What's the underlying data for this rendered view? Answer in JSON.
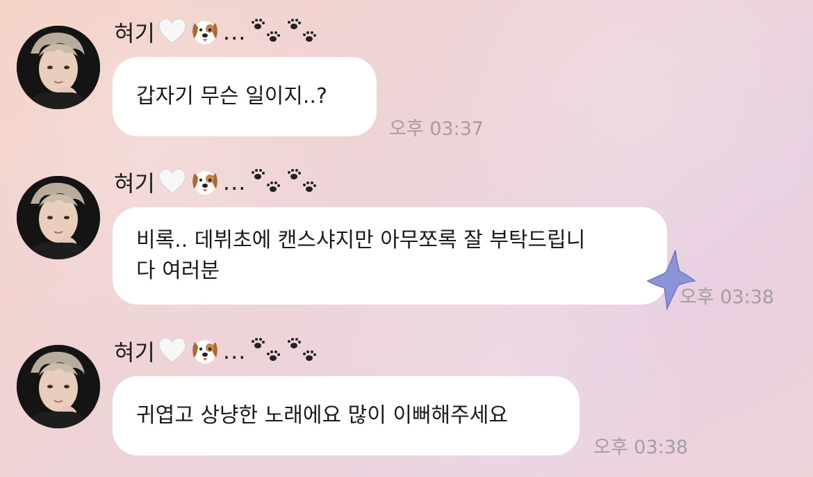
{
  "messages": [
    {
      "sender": "혀기",
      "sender_suffix": "...",
      "sender_icons": [
        "white-heart-icon",
        "dog-face-icon",
        "paw-prints-icon",
        "paw-prints-icon"
      ],
      "text": "갑자기 무슨 일이지..?",
      "time": "오후 03:37"
    },
    {
      "sender": "혀기",
      "sender_suffix": "...",
      "sender_icons": [
        "white-heart-icon",
        "dog-face-icon",
        "paw-prints-icon",
        "paw-prints-icon"
      ],
      "text": "비록.. 데뷔초에 캔스샤지만 아무쪼록 잘 부탁드립니\n다 여러분",
      "time": "오후 03:38"
    },
    {
      "sender": "혀기",
      "sender_suffix": "...",
      "sender_icons": [
        "white-heart-icon",
        "dog-face-icon",
        "paw-prints-icon",
        "paw-prints-icon"
      ],
      "text": "귀엽고 상냥한 노래에요 많이 이뻐해주세요",
      "time": "오후 03:38"
    }
  ],
  "colors": {
    "bubble": "#ffffff",
    "timestamp": "#a49da3",
    "star_sticker": "#8a93d8"
  }
}
